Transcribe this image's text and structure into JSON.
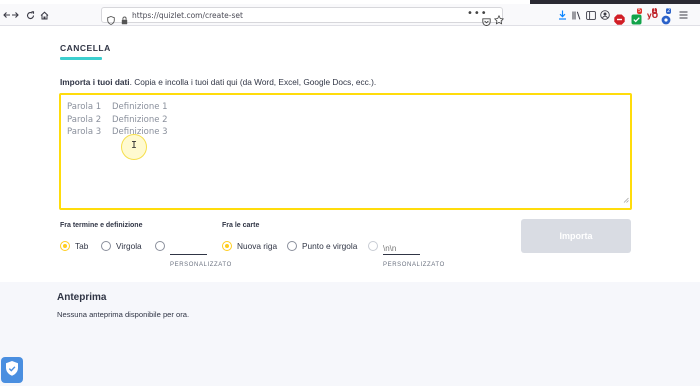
{
  "browser": {
    "url": "https://quizlet.com/create-set",
    "badges": {
      "adblock": "5",
      "ext_red": "1",
      "ext_blue": "2"
    },
    "ext_label": "yO"
  },
  "page": {
    "tab_label": "CANCELLA",
    "import_label_bold": "Importa i tuoi dati",
    "import_label_rest": ". Copia e incolla i tuoi dati qui (da Word, Excel, Google Docs, ecc.).",
    "textarea_placeholder": "Parola 1    Definizione 1\nParola 2    Definizione 2\nParola 3    Definizione 3",
    "between_term": {
      "title": "Fra termine e definizione",
      "options": [
        {
          "label": "Tab",
          "selected": true
        },
        {
          "label": "Virgola",
          "selected": false
        },
        {
          "label": "",
          "selected": false
        }
      ],
      "custom_label": "PERSONALIZZATO"
    },
    "between_cards": {
      "title": "Fra le carte",
      "options": [
        {
          "label": "Nuova riga",
          "selected": true
        },
        {
          "label": "Punto e virgola",
          "selected": false
        },
        {
          "label": "",
          "selected": false
        }
      ],
      "custom_placeholder": "\\n\\n",
      "custom_label": "PERSONALIZZATO"
    },
    "import_button": "Importa",
    "preview_title": "Anteprima",
    "preview_empty": "Nessuna anteprima disponibile per ora."
  },
  "colors": {
    "accent_yellow": "#ffdc0c",
    "tab_underline": "#3ccfcf",
    "disabled_button": "#d9dce3",
    "preview_bg": "#f6f7fb"
  },
  "icons": [
    "back-arrow-icon",
    "forward-arrow-icon",
    "reload-icon",
    "home-icon",
    "shield-icon",
    "lock-icon",
    "more-icon",
    "pocket-icon",
    "star-icon",
    "download-icon",
    "library-icon",
    "sidebar-icon",
    "account-icon",
    "adblock-icon",
    "extension-icon",
    "menu-icon",
    "resize-grip-icon",
    "privacy-shield-icon"
  ]
}
